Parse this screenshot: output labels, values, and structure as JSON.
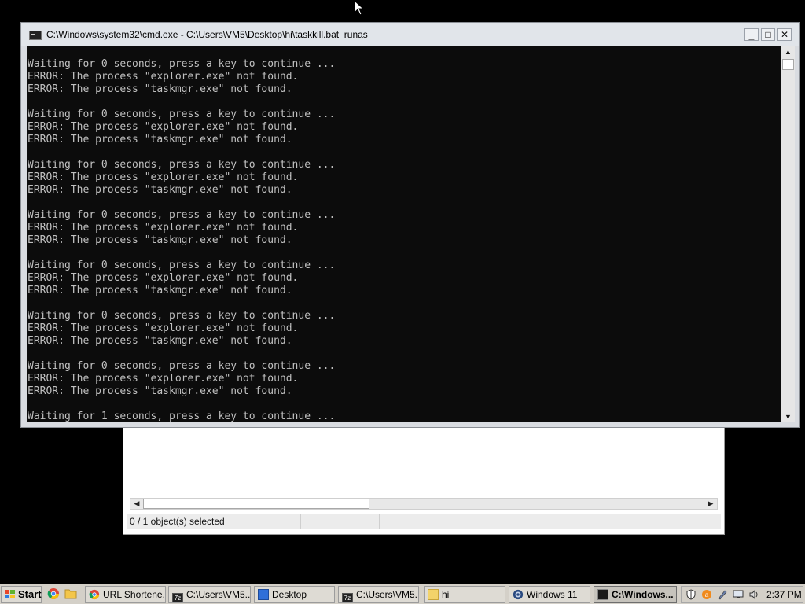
{
  "cmd_window": {
    "title": "C:\\Windows\\system32\\cmd.exe - C:\\Users\\VM5\\Desktop\\hi\\taskkill.bat  runas",
    "controls": {
      "minimize": "_",
      "maximize": "□",
      "close": "✕"
    },
    "console_lines": [
      "Waiting for 0 seconds, press a key to continue ...",
      "ERROR: The process \"explorer.exe\" not found.",
      "ERROR: The process \"taskmgr.exe\" not found.",
      "",
      "Waiting for 0 seconds, press a key to continue ...",
      "ERROR: The process \"explorer.exe\" not found.",
      "ERROR: The process \"taskmgr.exe\" not found.",
      "",
      "Waiting for 0 seconds, press a key to continue ...",
      "ERROR: The process \"explorer.exe\" not found.",
      "ERROR: The process \"taskmgr.exe\" not found.",
      "",
      "Waiting for 0 seconds, press a key to continue ...",
      "ERROR: The process \"explorer.exe\" not found.",
      "ERROR: The process \"taskmgr.exe\" not found.",
      "",
      "Waiting for 0 seconds, press a key to continue ...",
      "ERROR: The process \"explorer.exe\" not found.",
      "ERROR: The process \"taskmgr.exe\" not found.",
      "",
      "Waiting for 0 seconds, press a key to continue ...",
      "ERROR: The process \"explorer.exe\" not found.",
      "ERROR: The process \"taskmgr.exe\" not found.",
      "",
      "Waiting for 0 seconds, press a key to continue ...",
      "ERROR: The process \"explorer.exe\" not found.",
      "ERROR: The process \"taskmgr.exe\" not found.",
      "",
      "Waiting for 1 seconds, press a key to continue ..."
    ],
    "console_text_color": "#c0c0c0",
    "console_bg_color": "#0c0c0c"
  },
  "explorer_window": {
    "status_text": "0 / 1 object(s) selected"
  },
  "taskbar": {
    "start_label": "Start",
    "quick_launch": [
      "chrome-icon",
      "folder-icon"
    ],
    "buttons": [
      {
        "label": "URL Shortene...",
        "icon": "chrome-icon"
      },
      {
        "label": "C:\\Users\\VM5...",
        "icon": "7zip-icon"
      },
      {
        "label": "Desktop",
        "icon": "desktop-icon"
      },
      {
        "label": "C:\\Users\\VM5...",
        "icon": "7zip-icon"
      },
      {
        "label": "hi",
        "icon": "folder-icon"
      },
      {
        "label": "Windows 11",
        "icon": "windows11-icon"
      },
      {
        "label": "C:\\Windows...",
        "icon": "cmd-icon",
        "active": true
      }
    ],
    "tray_icons": [
      "shield-icon",
      "avast-icon",
      "pen-icon",
      "network-icon",
      "volume-icon",
      "battery-icon"
    ],
    "clock": "2:37 PM"
  }
}
